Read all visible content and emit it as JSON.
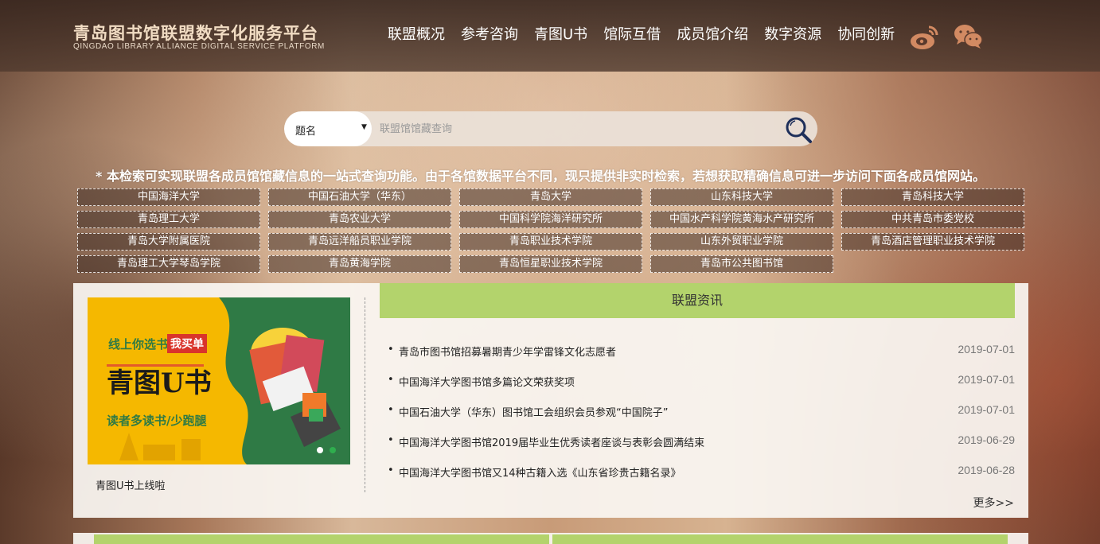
{
  "header": {
    "logo_cn": "青岛图书馆联盟数字化服务平台",
    "logo_en": "QINGDAO LIBRARY ALLIANCE DIGITAL SERVICE PLATFORM",
    "nav": [
      "联盟概况",
      "参考咨询",
      "青图U书",
      "馆际互借",
      "成员馆介绍",
      "数字资源",
      "协同创新"
    ],
    "social": [
      "weibo-icon",
      "wechat-icon"
    ]
  },
  "search": {
    "field_selected": "题名",
    "placeholder": "联盟馆馆藏查询"
  },
  "notice": "* 本检索可实现联盟各成员馆馆藏信息的一站式查询功能。由于各馆数据平台不同，现只提供非实时检索，若想获取精确信息可进一步访问下面各成员馆网站。",
  "members": [
    "中国海洋大学",
    "中国石油大学（华东）",
    "青岛大学",
    "山东科技大学",
    "青岛科技大学",
    "青岛理工大学",
    "青岛农业大学",
    "中国科学院海洋研究所",
    "中国水产科学院黄海水产研究所",
    "中共青岛市委党校",
    "青岛大学附属医院",
    "青岛远洋船员职业学院",
    "青岛职业技术学院",
    "山东外贸职业学院",
    "青岛酒店管理职业技术学院",
    "青岛理工大学琴岛学院",
    "青岛黄海学院",
    "青岛恒星职业技术学院",
    "青岛市公共图书馆"
  ],
  "banner": {
    "line1": "线上你选书",
    "tag": "我买单",
    "title": "青图U书",
    "line3": "读者多读书/少跑腿",
    "caption": "青图U书上线啦"
  },
  "news": {
    "heading": "联盟资讯",
    "items": [
      {
        "title": "青岛市图书馆招募暑期青少年学雷锋文化志愿者",
        "date": "2019-07-01"
      },
      {
        "title": "中国海洋大学图书馆多篇论文荣获奖项",
        "date": "2019-07-01"
      },
      {
        "title": "中国石油大学（华东）图书馆工会组织会员参观“中国院子”",
        "date": "2019-07-01"
      },
      {
        "title": "中国海洋大学图书馆2019届毕业生优秀读者座谈与表彰会圆满结束",
        "date": "2019-06-29"
      },
      {
        "title": "中国海洋大学图书馆又14种古籍入选《山东省珍贵古籍名录》",
        "date": "2019-06-28"
      }
    ],
    "more": "更多>>"
  },
  "colors": {
    "accent_green": "#b3d36c",
    "header_bg": "#3a2820",
    "banner_yellow": "#f5b800",
    "banner_green": "#2f7a45"
  }
}
